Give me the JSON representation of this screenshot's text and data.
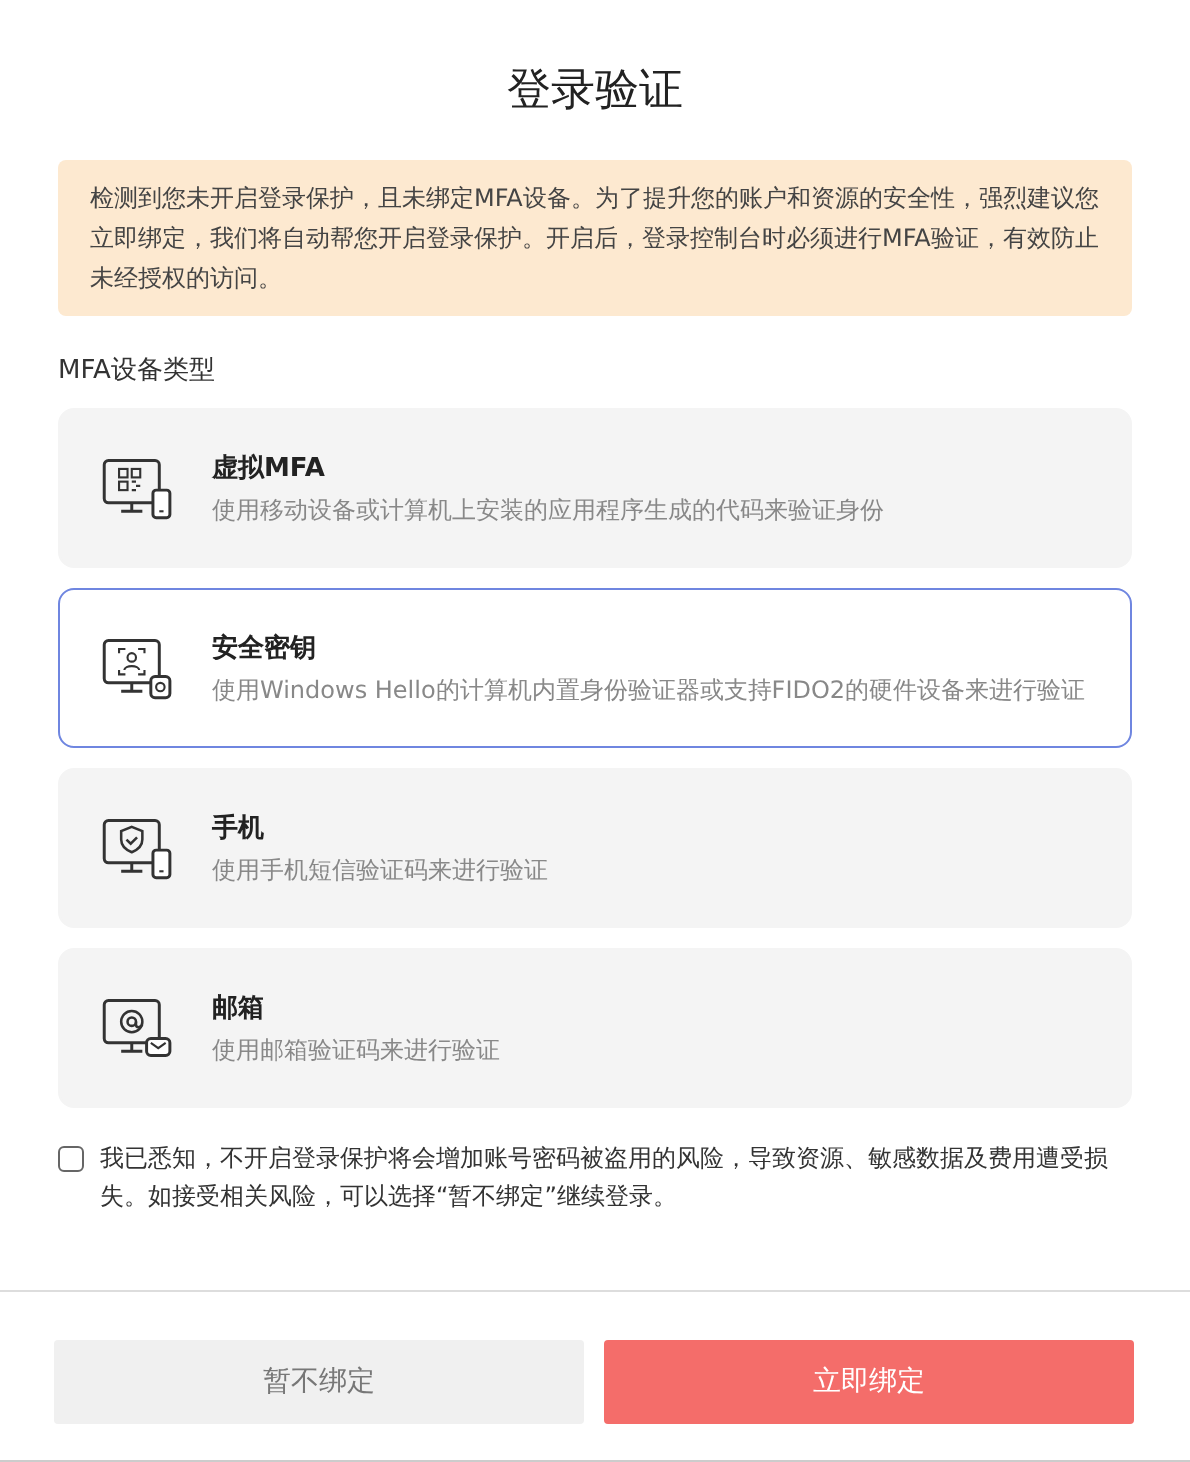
{
  "title": "登录验证",
  "notice": "检测到您未开启登录保护，且未绑定MFA设备。为了提升您的账户和资源的安全性，强烈建议您立即绑定，我们将自动帮您开启登录保护。开启后，登录控制台时必须进行MFA验证，有效防止未经授权的访问。",
  "section_label": "MFA设备类型",
  "devices": [
    {
      "name": "虚拟MFA",
      "description": "使用移动设备或计算机上安装的应用程序生成的代码来验证身份",
      "selected": false
    },
    {
      "name": "安全密钥",
      "description": "使用Windows Hello的计算机内置身份验证器或支持FIDO2的硬件设备来进行验证",
      "selected": true
    },
    {
      "name": "手机",
      "description": "使用手机短信验证码来进行验证",
      "selected": false
    },
    {
      "name": "邮箱",
      "description": "使用邮箱验证码来进行验证",
      "selected": false
    }
  ],
  "acknowledge": {
    "text": "我已悉知，不开启登录保护将会增加账号密码被盗用的风险，导致资源、敏感数据及费用遭受损失。如接受相关风险，可以选择“暂不绑定”继续登录。",
    "checked": false
  },
  "buttons": [
    {
      "label": "暂不绑定",
      "kind": "secondary"
    },
    {
      "label": "立即绑定",
      "kind": "primary"
    }
  ]
}
